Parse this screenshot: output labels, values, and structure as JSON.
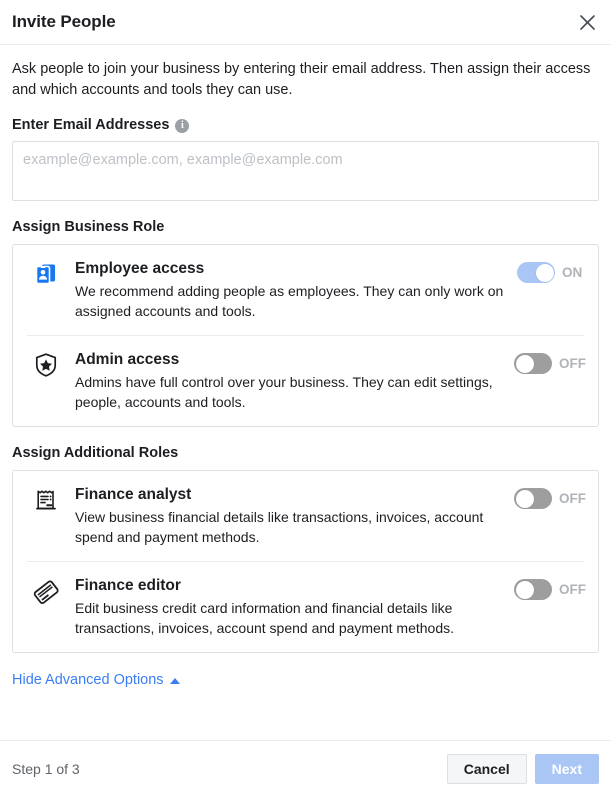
{
  "header": {
    "title": "Invite People",
    "close_label": "×"
  },
  "body": {
    "intro": "Ask people to join your business by entering their email address. Then assign their access and which accounts and tools they can use."
  },
  "email": {
    "label": "Enter Email Addresses",
    "info_glyph": "i",
    "placeholder": "example@example.com, example@example.com",
    "value": ""
  },
  "business_role": {
    "label": "Assign Business Role",
    "items": [
      {
        "icon": "employee-badge-icon",
        "title": "Employee access",
        "description": "We recommend adding people as employees. They can only work on assigned accounts and tools.",
        "toggle_state": "on",
        "toggle_label": "ON"
      },
      {
        "icon": "shield-star-icon",
        "title": "Admin access",
        "description": "Admins have full control over your business. They can edit settings, people, accounts and tools.",
        "toggle_state": "off",
        "toggle_label": "OFF"
      }
    ]
  },
  "additional_roles": {
    "label": "Assign Additional Roles",
    "items": [
      {
        "icon": "receipt-icon",
        "title": "Finance analyst",
        "description": "View business financial details like transactions, invoices, account spend and payment methods.",
        "toggle_state": "off",
        "toggle_label": "OFF"
      },
      {
        "icon": "credit-card-icon",
        "title": "Finance editor",
        "description": "Edit business credit card information and financial details like transactions, invoices, account spend and payment methods.",
        "toggle_state": "off",
        "toggle_label": "OFF"
      }
    ]
  },
  "advanced": {
    "link_label": "Hide Advanced Options"
  },
  "footer": {
    "step_text": "Step 1 of 3",
    "cancel_label": "Cancel",
    "next_label": "Next"
  },
  "colors": {
    "link_blue": "#3b7df5",
    "toggle_on": "#a9c6f5",
    "toggle_off": "#9e9e9e",
    "primary_button": "#a9c6f5",
    "icon_blue": "#1877f2"
  }
}
